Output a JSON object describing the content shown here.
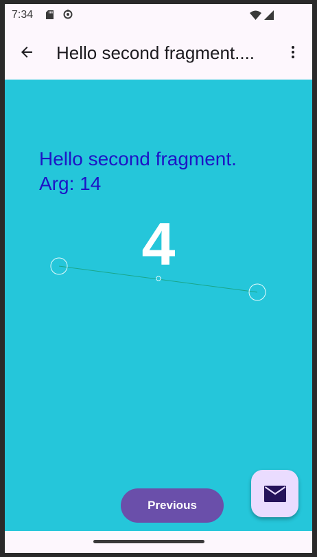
{
  "status_bar": {
    "time": "7:34",
    "icons": [
      "sd-card-icon",
      "sync-icon",
      "wifi-icon",
      "cell-signal-icon"
    ]
  },
  "app_bar": {
    "title": "Hello second fragment....",
    "back_icon": "arrow-back-icon",
    "menu_icon": "more-vert-icon"
  },
  "content": {
    "message_line1": "Hello second fragment.",
    "message_line2": "Arg: 14",
    "number": "4",
    "background_color": "#25c6da",
    "message_color": "#1d14c6"
  },
  "actions": {
    "previous_label": "Previous",
    "fab_icon": "email-icon",
    "primary_color": "#6a4faa",
    "fab_color": "#eadcff"
  }
}
